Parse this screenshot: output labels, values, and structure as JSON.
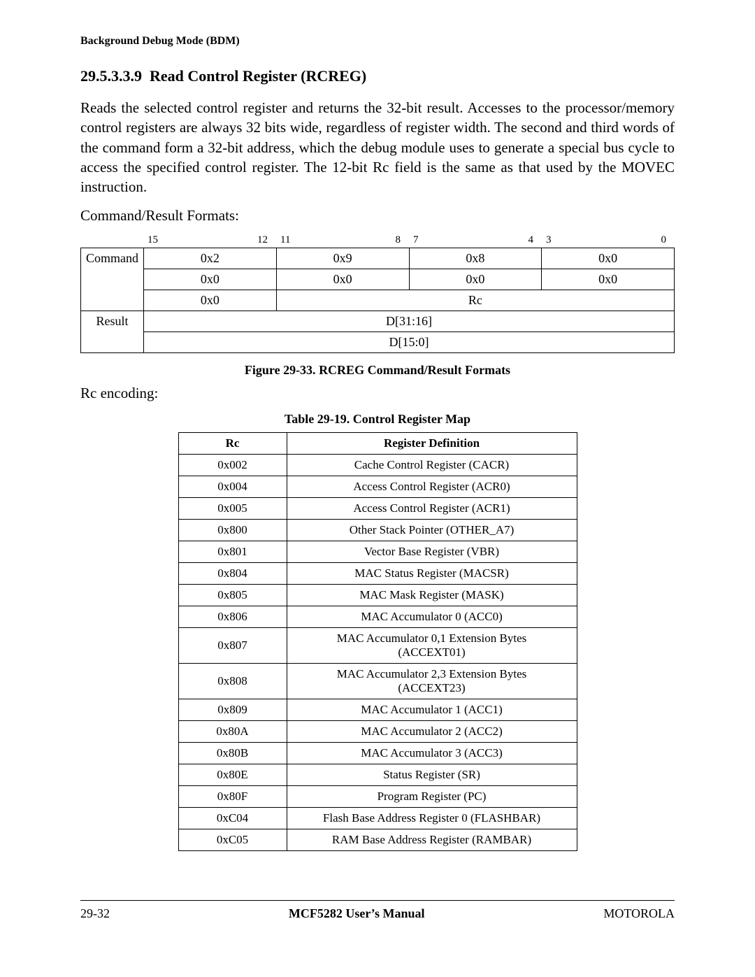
{
  "header": "Background Debug Mode (BDM)",
  "heading_number": "29.5.3.3.9",
  "heading_title_a": "Read Control Register (",
  "heading_title_b": "RCREG",
  "heading_title_c": ")",
  "paragraph": "Reads the selected control register and returns the 32-bit result. Accesses to the processor/memory control registers are always 32 bits wide, regardless of register width. The second and third words of the command form a 32-bit address, which the debug module uses to generate a special bus cycle to access the specified control register. The 12-bit Rc field is the same as that used by the MOVEC instruction.",
  "label_formats": "Command/Result Formats:",
  "bits": {
    "g1a": "15",
    "g1b": "12",
    "g2a": "11",
    "g2b": "8",
    "g3a": "7",
    "g3b": "4",
    "g4a": "3",
    "g4b": "0"
  },
  "fmt": {
    "command_label": "Command",
    "result_label": "Result",
    "r1": {
      "c1": "0x2",
      "c2": "0x9",
      "c3": "0x8",
      "c4": "0x0"
    },
    "r2": {
      "c1": "0x0",
      "c2": "0x0",
      "c3": "0x0",
      "c4": "0x0"
    },
    "r3": {
      "c1": "0x0",
      "rc": "Rc"
    },
    "r4": "D[31:16]",
    "r5": "D[15:0]"
  },
  "figcap_a": "Figure 29-33. ",
  "figcap_b": "RCREG",
  "figcap_c": " Command/Result Formats",
  "label_rc": "Rc encoding:",
  "tblcap": "Table 29-19. Control Register Map",
  "reg_head": {
    "c1": "Rc",
    "c2": "Register Definition"
  },
  "reg_rows": [
    {
      "rc": "0x002",
      "def": "Cache Control Register (CACR)"
    },
    {
      "rc": "0x004",
      "def": "Access Control Register (ACR0)"
    },
    {
      "rc": "0x005",
      "def": "Access Control Register (ACR1)"
    },
    {
      "rc": "0x800",
      "def": "Other Stack Pointer (OTHER_A7)"
    },
    {
      "rc": "0x801",
      "def": "Vector Base Register (VBR)"
    },
    {
      "rc": "0x804",
      "def": "MAC Status Register (MACSR)"
    },
    {
      "rc": "0x805",
      "def": "MAC Mask Register (MASK)"
    },
    {
      "rc": "0x806",
      "def": "MAC Accumulator 0 (ACC0)"
    },
    {
      "rc": "0x807",
      "def": "MAC Accumulator 0,1 Extension Bytes (ACCEXT01)"
    },
    {
      "rc": "0x808",
      "def": "MAC Accumulator 2,3 Extension Bytes (ACCEXT23)"
    },
    {
      "rc": "0x809",
      "def": "MAC Accumulator 1 (ACC1)"
    },
    {
      "rc": "0x80A",
      "def": "MAC Accumulator 2 (ACC2)"
    },
    {
      "rc": "0x80B",
      "def": "MAC Accumulator 3 (ACC3)"
    },
    {
      "rc": "0x80E",
      "def": "Status Register (SR)"
    },
    {
      "rc": "0x80F",
      "def": "Program Register (PC)"
    },
    {
      "rc": "0xC04",
      "def": "Flash Base Address Register 0 (FLASHBAR)"
    },
    {
      "rc": "0xC05",
      "def": "RAM Base Address Register (RAMBAR)"
    }
  ],
  "footer": {
    "left": "29-32",
    "center": "MCF5282 User’s Manual",
    "right": "MOTOROLA"
  }
}
